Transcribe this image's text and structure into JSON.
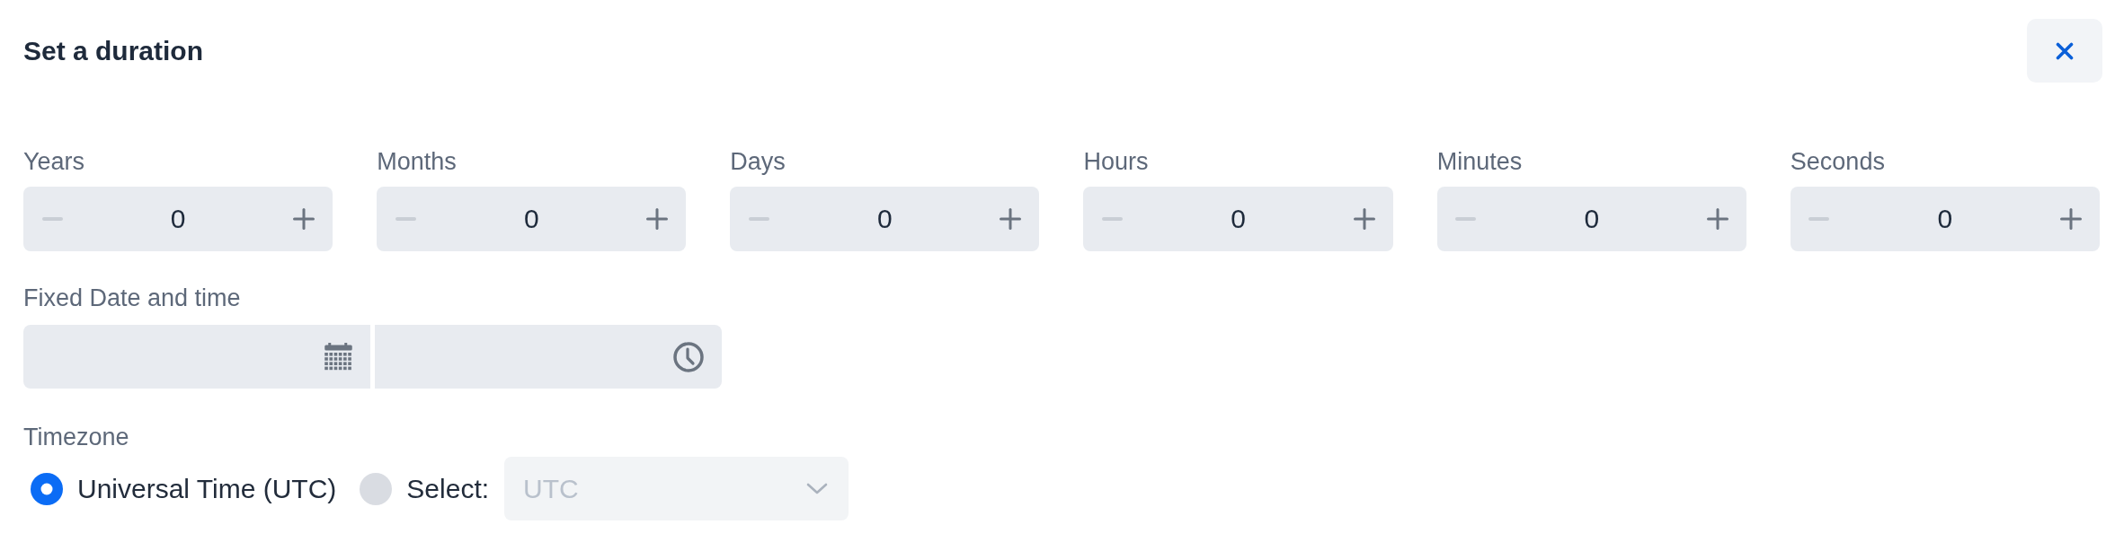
{
  "header": {
    "title": "Set a duration"
  },
  "duration_fields": [
    {
      "label": "Years",
      "value": "0",
      "decrement_disabled": true,
      "increment_disabled": false
    },
    {
      "label": "Months",
      "value": "0",
      "decrement_disabled": true,
      "increment_disabled": false
    },
    {
      "label": "Days",
      "value": "0",
      "decrement_disabled": true,
      "increment_disabled": false
    },
    {
      "label": "Hours",
      "value": "0",
      "decrement_disabled": true,
      "increment_disabled": false
    },
    {
      "label": "Minutes",
      "value": "0",
      "decrement_disabled": true,
      "increment_disabled": false
    },
    {
      "label": "Seconds",
      "value": "0",
      "decrement_disabled": true,
      "increment_disabled": false
    }
  ],
  "fixed_date_time": {
    "label": "Fixed Date and time",
    "fields": [
      {
        "kind": "date"
      },
      {
        "kind": "time"
      }
    ]
  },
  "timezone": {
    "label": "Timezone",
    "options": [
      {
        "kind": "plain",
        "label": "Universal Time (UTC)",
        "selected": true
      },
      {
        "kind": "select",
        "label": "Select:",
        "selected": false,
        "select": {
          "value": "UTC",
          "disabled": true
        }
      }
    ]
  }
}
